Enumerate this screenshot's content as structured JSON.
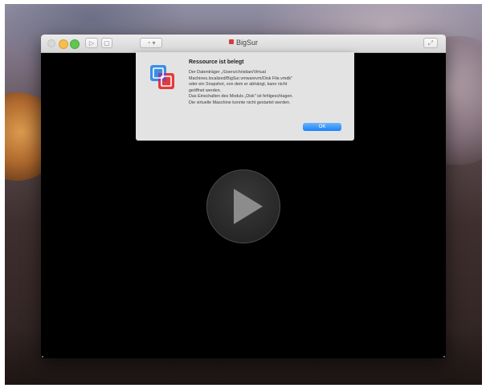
{
  "window": {
    "title": "BigSur"
  },
  "dialog": {
    "title": "Ressource ist belegt",
    "message_lines": [
      "Der Datenträger „/Users/christian/Virtual",
      "Machines.localized/BigSur.vmwarevm/Disk File.vmdk\"",
      "oder ein Snapshot, von dem er abhängt, kann nicht",
      "geöffnet werden.",
      "Das Einschalten des Moduls „Disk\" ist fehlgeschlagen.",
      "Die virtuelle Maschine konnte nicht gestartet werden."
    ],
    "ok_label": "OK"
  },
  "colors": {
    "accent": "#1a82fb",
    "traffic_min": "#f5bf4f",
    "traffic_max": "#61c554",
    "app_icon_blue": "#3b8ee6",
    "app_icon_red": "#e23b3b"
  },
  "icons": {
    "app": "vmware-fusion-icon",
    "play": "play-icon"
  }
}
